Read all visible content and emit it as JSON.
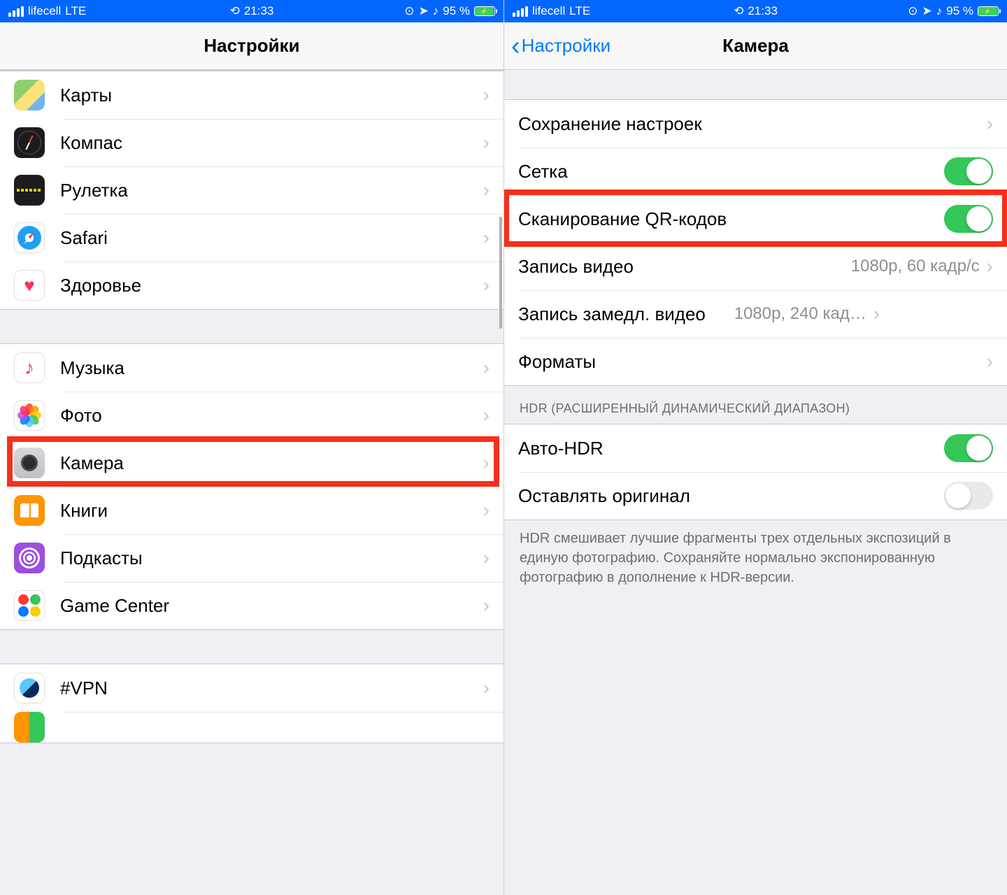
{
  "status": {
    "carrier": "lifecell",
    "network": "LTE",
    "time": "21:33",
    "battery_pct": "95 %",
    "hotspot_glyph": "⎋",
    "lock_glyph": "⦿",
    "arrow_glyph": "➤",
    "headphones_glyph": "♫"
  },
  "left": {
    "title": "Настройки",
    "groups": [
      [
        {
          "id": "maps",
          "label": "Карты"
        },
        {
          "id": "compass",
          "label": "Компас"
        },
        {
          "id": "measure",
          "label": "Рулетка"
        },
        {
          "id": "safari",
          "label": "Safari"
        },
        {
          "id": "health",
          "label": "Здоровье"
        }
      ],
      [
        {
          "id": "music",
          "label": "Музыка"
        },
        {
          "id": "photos",
          "label": "Фото"
        },
        {
          "id": "camera",
          "label": "Камера"
        },
        {
          "id": "books",
          "label": "Книги"
        },
        {
          "id": "podcasts",
          "label": "Подкасты"
        },
        {
          "id": "gamecenter",
          "label": "Game Center"
        }
      ],
      [
        {
          "id": "vpn",
          "label": "#VPN"
        }
      ]
    ],
    "highlighted": "camera"
  },
  "right": {
    "back": "Настройки",
    "title": "Камера",
    "rows": {
      "preserve": "Сохранение настроек",
      "grid": "Сетка",
      "qr": "Сканирование QR-кодов",
      "video": "Запись видео",
      "video_detail": "1080p, 60 кадр/с",
      "slomo": "Запись замедл. видео",
      "slomo_detail": "1080p, 240 кад…",
      "formats": "Форматы",
      "hdr_header": "HDR (РАСШИРЕННЫЙ ДИНАМИЧЕСКИЙ ДИАПАЗОН)",
      "auto_hdr": "Авто-HDR",
      "keep_orig": "Оставлять оригинал",
      "hdr_footer": "HDR смешивает лучшие фрагменты трех отдельных экспозиций в единую фотографию. Сохраняйте нормально экспонированную фотографию в дополнение к HDR-версии."
    },
    "toggles": {
      "grid": true,
      "qr": true,
      "auto_hdr": true,
      "keep_orig": false
    },
    "highlighted": "qr"
  }
}
